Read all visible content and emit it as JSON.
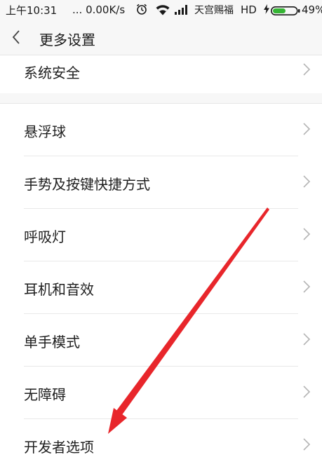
{
  "status_bar": {
    "time": "上午10:31",
    "speed": "... 0.00K/s",
    "carrier": "天宫赐福",
    "network": "HD",
    "battery": "49%",
    "icons": [
      "alarm-icon",
      "wifi-icon",
      "signal-icon",
      "charging-icon",
      "battery-icon"
    ]
  },
  "header": {
    "back_icon": "chevron-left-icon",
    "title": "更多设置"
  },
  "settings": {
    "top_item": "系统安全",
    "items": [
      "悬浮球",
      "手势及按键快捷方式",
      "呼吸灯",
      "耳机和音效",
      "单手模式",
      "无障碍",
      "开发者选项"
    ]
  },
  "colors": {
    "background": "#f7f7f7",
    "row_background": "#ffffff",
    "chevron": "#b5b5b5",
    "annotation_arrow": "#e8262b"
  }
}
